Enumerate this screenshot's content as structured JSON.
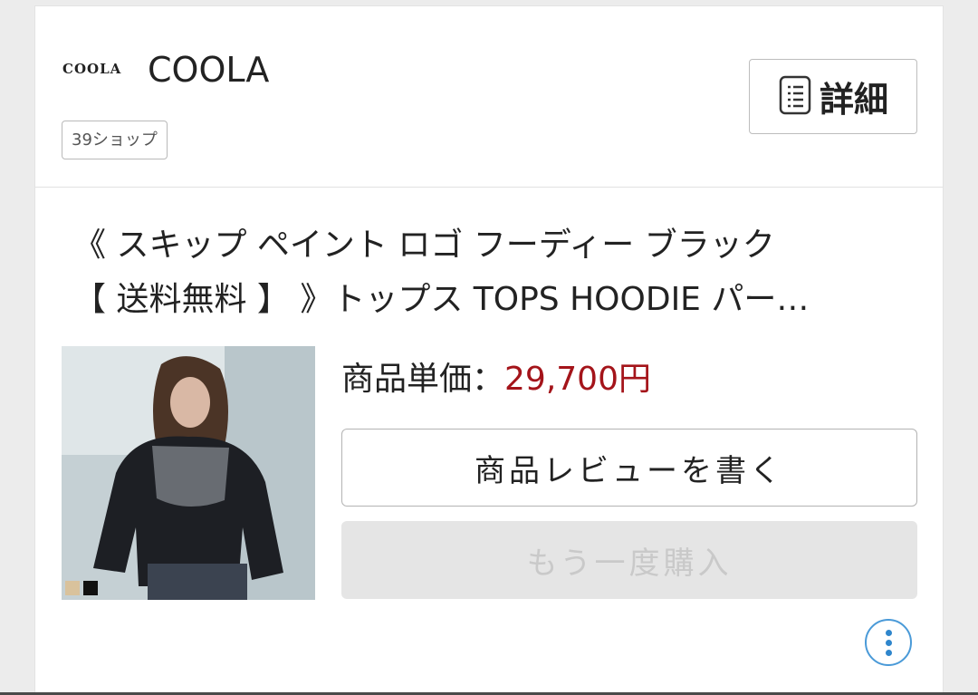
{
  "shop": {
    "logo_text": "COOLA",
    "name": "COOLA",
    "badge": "39ショップ",
    "detail_label": "詳細"
  },
  "product": {
    "title_line1": "《 スキップ ペイント ロゴ フーディー ブラック",
    "title_line2": "【 送料無料 】 》トップス TOPS HOODIE パー…",
    "price_label": "商品単価：",
    "price_value": "29,700円",
    "swatches": [
      "#d9c29c",
      "#111111"
    ]
  },
  "actions": {
    "review_label": "商品レビューを書く",
    "rebuy_label": "もう一度購入"
  },
  "colors": {
    "price": "#a4141a",
    "accent": "#2f86cc"
  }
}
